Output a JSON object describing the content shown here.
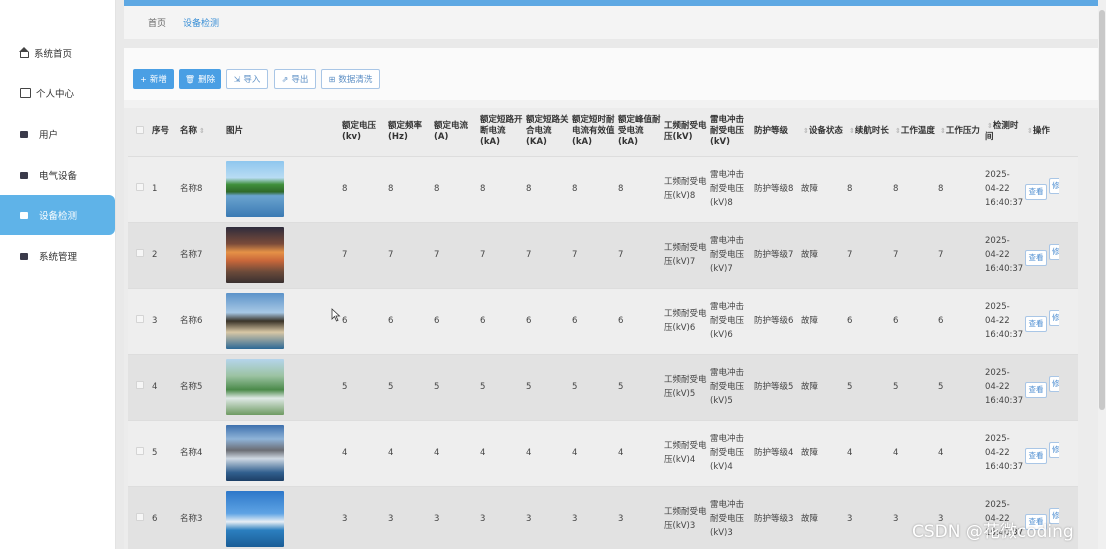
{
  "sidebar": {
    "items": [
      {
        "label": "系统首页",
        "icon": "home-icon"
      },
      {
        "label": "个人中心",
        "icon": "id-card-icon"
      },
      {
        "label": "用户",
        "icon": "user-icon"
      },
      {
        "label": "电气设备",
        "icon": "device-icon"
      },
      {
        "label": "设备检测",
        "icon": "monitor-icon",
        "active": true
      },
      {
        "label": "系统管理",
        "icon": "settings-icon"
      }
    ]
  },
  "breadcrumb": {
    "home": "首页",
    "current": "设备检测"
  },
  "toolbar": {
    "add": "新增",
    "delete": "删除",
    "import": "导入",
    "export": "导出",
    "clean": "数据清洗"
  },
  "table": {
    "headers": {
      "index": "序号",
      "name": "名称",
      "image": "图片",
      "rated_voltage": "额定电压(kv)",
      "rated_freq": "额定频率(Hz)",
      "rated_current": "额定电流(A)",
      "rated_sc_break": "额定短路开断电流(kA)",
      "rated_sc_make": "额定短路关合电流(KA)",
      "rated_st_current": "额定短时耐电流有效值(kA)",
      "rated_peak": "额定峰值耐受电流(kA)",
      "pf_withstand": "工频耐受电压(kV)",
      "lightning_withstand": "雷电冲击耐受电压(kV)",
      "protection": "防护等级",
      "status": "设备状态",
      "endurance": "续航时长",
      "temperature": "工作温度",
      "pressure": "工作压力",
      "detect_time": "检测时间",
      "action": "操作"
    },
    "view_label": "查看",
    "edit_label": "修",
    "rows": [
      {
        "index": "1",
        "name": "名称8",
        "v": "8",
        "pf": "工频耐受电压(kV)8",
        "lw": "雷电冲击耐受电压(kV)8",
        "protection": "防护等级8",
        "status": "故障",
        "time": "2025-04-22 16:40:37"
      },
      {
        "index": "2",
        "name": "名称7",
        "v": "7",
        "pf": "工频耐受电压(kV)7",
        "lw": "雷电冲击耐受电压(kV)7",
        "protection": "防护等级7",
        "status": "故障",
        "time": "2025-04-22 16:40:37"
      },
      {
        "index": "3",
        "name": "名称6",
        "v": "6",
        "pf": "工频耐受电压(kV)6",
        "lw": "雷电冲击耐受电压(kV)6",
        "protection": "防护等级6",
        "status": "故障",
        "time": "2025-04-22 16:40:37"
      },
      {
        "index": "4",
        "name": "名称5",
        "v": "5",
        "pf": "工频耐受电压(kV)5",
        "lw": "雷电冲击耐受电压(kV)5",
        "protection": "防护等级5",
        "status": "故障",
        "time": "2025-04-22 16:40:37"
      },
      {
        "index": "5",
        "name": "名称4",
        "v": "4",
        "pf": "工频耐受电压(kV)4",
        "lw": "雷电冲击耐受电压(kV)4",
        "protection": "防护等级4",
        "status": "故障",
        "time": "2025-04-22 16:40:37"
      },
      {
        "index": "6",
        "name": "名称3",
        "v": "3",
        "pf": "工频耐受电压(kV)3",
        "lw": "雷电冲击耐受电压(kV)3",
        "protection": "防护等级3",
        "status": "故障",
        "time": "2025-04-22 16:40:37"
      }
    ]
  },
  "watermark": "CSDN @花微coding",
  "colors": {
    "accent": "#4a9fe4",
    "sidebar_active": "#5fb3e8"
  }
}
